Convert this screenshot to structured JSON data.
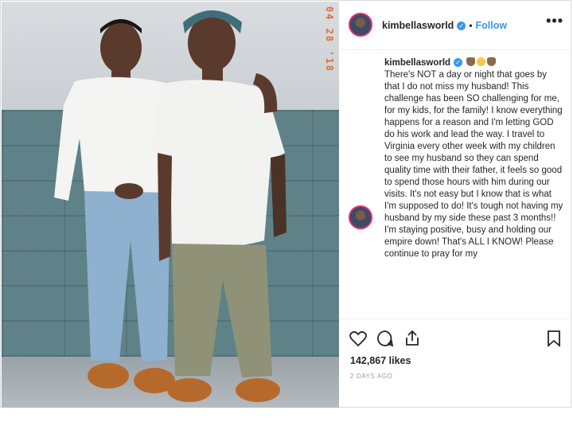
{
  "photo": {
    "stamp_text": "04 28 '18",
    "description_icon": "photo"
  },
  "post": {
    "username": "kimbellasworld",
    "follow_label": "Follow",
    "separator": "•",
    "more_label": "•••",
    "caption_user": "kimbellasworld",
    "caption_text": "There's NOT a day or night that goes by that I do not miss my husband! This challenge has been SO challenging for me, for my kids, for the family! I know everything happens for a reason and I'm letting GOD do his work and lead the way. I travel to Virginia every other week with my children to see my husband so they can spend quality time with their father, it feels so good to spend those hours with him during our visits. It's not easy but I know that is what I'm supposed to do! It's tough not having my husband by my side these past 3 months!! I'm staying positive, busy and holding our empire down! That's ALL I KNOW! Please continue to pray for my",
    "likes": "142,867 likes",
    "time_ago": "2 DAYS AGO"
  },
  "icons": {
    "verified": "verified-badge-icon",
    "like": "heart-icon",
    "comment": "comment-icon",
    "share": "share-icon",
    "save": "bookmark-icon",
    "more": "more-options-icon"
  },
  "colors": {
    "accent": "#3897f0",
    "story_ring": "#e1306c",
    "stamp": "#d8703a"
  }
}
